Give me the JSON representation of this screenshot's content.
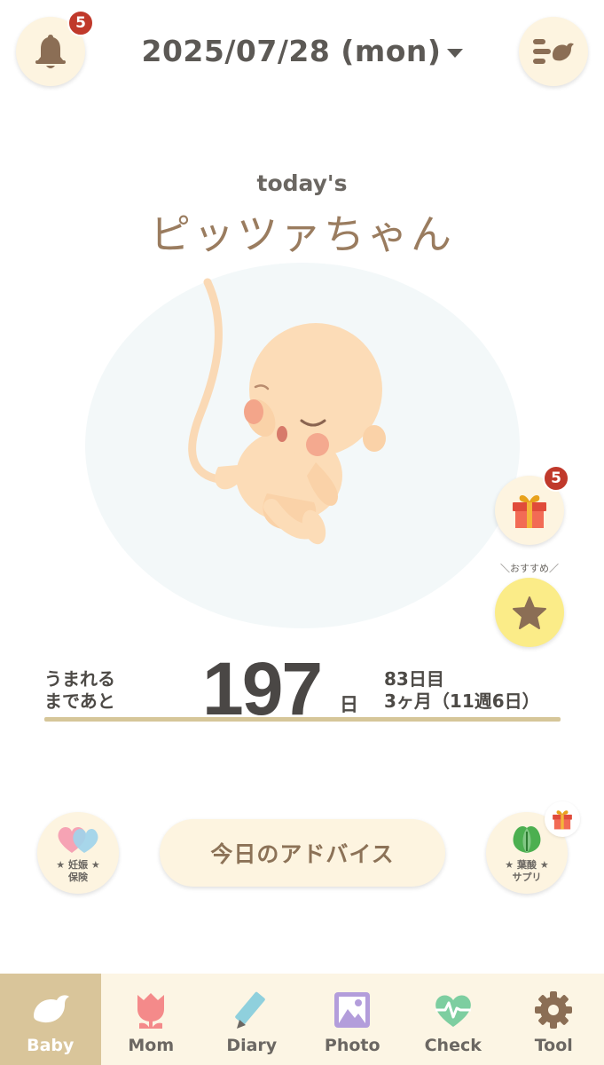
{
  "header": {
    "date": "2025/07/28 (mon)",
    "notification_count": "5",
    "bell_icon": "bell-icon",
    "menu_icon": "menu-bird-icon"
  },
  "hero": {
    "today_label": "today's",
    "baby_name": "ピッツァちゃん",
    "illustration": "fetus-illustration"
  },
  "side": {
    "gift_count": "5",
    "gift_icon": "gift-icon",
    "recommend_label": "＼おすすめ／",
    "star_icon": "star-icon"
  },
  "countdown": {
    "label_line1": "うまれる",
    "label_line2": "まであと",
    "days": "197",
    "unit": "日",
    "days_elapsed": "83日目",
    "months_weeks": "3ヶ月（11週6日）"
  },
  "actions": {
    "advice_label": "今日のアドバイス",
    "insurance_line1": "★ 妊娠 ★",
    "insurance_line2": "保険",
    "supplement_line1": "★ 葉酸 ★",
    "supplement_line2": "サプリ"
  },
  "nav": {
    "items": [
      {
        "label": "Baby",
        "icon": "bird-icon",
        "active": true
      },
      {
        "label": "Mom",
        "icon": "tulip-icon"
      },
      {
        "label": "Diary",
        "icon": "pencil-icon"
      },
      {
        "label": "Photo",
        "icon": "photo-icon"
      },
      {
        "label": "Check",
        "icon": "heartbeat-icon"
      },
      {
        "label": "Tool",
        "icon": "gear-icon"
      }
    ]
  },
  "colors": {
    "accent": "#d9c59a",
    "cream": "#fdf4e0",
    "badge": "#c0392b",
    "name": "#9a7c5f"
  }
}
